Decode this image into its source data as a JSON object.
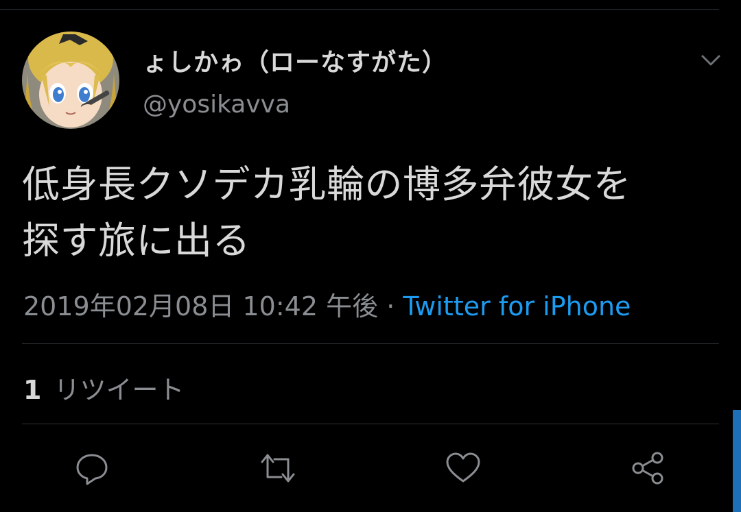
{
  "user": {
    "display_name": "ょしかゎ（ローなすがた）",
    "handle": "@yosikavva"
  },
  "tweet": {
    "text_line1": "低身長クソデカ乳輪の博多弁彼女を",
    "text_line2": "探す旅に出る",
    "timestamp": "2019年02月08日 10:42 午後",
    "separator": "·",
    "source": "Twitter for iPhone"
  },
  "stats": {
    "retweet_count": "1",
    "retweet_label": "リツイート"
  },
  "actions": {
    "icons": [
      "reply-icon",
      "retweet-icon",
      "like-icon",
      "share-icon"
    ]
  },
  "colors": {
    "background": "#000000",
    "text_primary": "#d9d9d9",
    "text_secondary": "#8a8d91",
    "accent": "#1d9bf0",
    "divider": "#2f3336"
  }
}
